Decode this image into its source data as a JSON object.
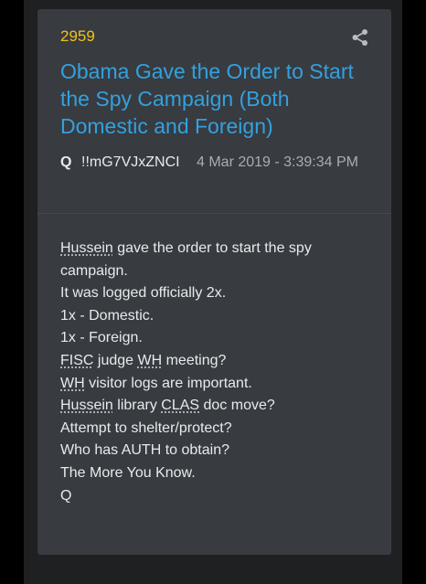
{
  "post": {
    "number": "2959",
    "title": "Obama Gave the Order to Start the Spy Campaign (Both Domestic and Foreign)",
    "author": "Q",
    "tripcode": "!!mG7VJxZNCI",
    "timestamp": "4 Mar 2019 - 3:39:34 PM",
    "share_icon": "share-icon"
  },
  "body": {
    "lines": [
      {
        "abbr": "Hussein",
        "rest": " gave the order to start the spy"
      },
      {
        "text": "campaign."
      },
      {
        "text": "It was logged officially 2x."
      },
      {
        "text": "1x - Domestic."
      },
      {
        "text": "1x - Foreign."
      },
      {
        "abbr1": "FISC",
        "mid": " judge ",
        "abbr2": "WH",
        "rest": " meeting?"
      },
      {
        "abbr": "WH",
        "rest": " visitor logs are important."
      },
      {
        "abbr1": "Hussein",
        "mid": " library ",
        "abbr2": "CLAS",
        "rest": " doc move?"
      },
      {
        "text": "Attempt to shelter/protect?"
      },
      {
        "text": "Who has AUTH to obtain?"
      },
      {
        "text": "The More You Know."
      },
      {
        "text": "Q"
      }
    ]
  },
  "colors": {
    "background": "#000000",
    "card": "#383b40",
    "number": "#f0c419",
    "title": "#33a1de",
    "text": "#e8eaed"
  }
}
